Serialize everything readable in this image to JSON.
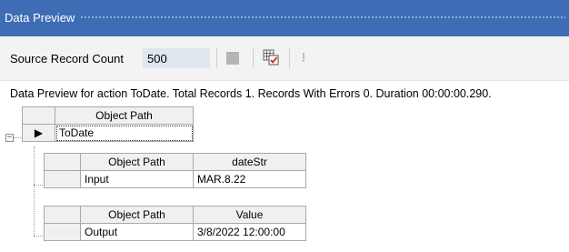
{
  "window": {
    "title": "Data Preview"
  },
  "toolbar": {
    "source_record_count_label": "Source Record Count",
    "source_record_count_value": "500",
    "stop_icon": "stop-icon",
    "grid_icon": "grid-check-icon",
    "warning_icon": "exclamation-icon",
    "warning_glyph": "!"
  },
  "status": {
    "message": "Data Preview for action ToDate. Total Records 1. Records With Errors 0. Duration 00:00:00.290."
  },
  "main_grid": {
    "header": "Object Path",
    "rows": [
      {
        "object_path": "ToDate",
        "expanded": true,
        "selected": true
      }
    ]
  },
  "child_grids": [
    {
      "headers": [
        "Object Path",
        "dateStr"
      ],
      "rows": [
        [
          "Input",
          "MAR.8.22"
        ]
      ]
    },
    {
      "headers": [
        "Object Path",
        "Value"
      ],
      "rows": [
        [
          "Output",
          "3/8/2022 12:00:00"
        ]
      ]
    }
  ],
  "colors": {
    "title_bar": "#3e6db5",
    "toolbar_bg": "#f3f3f3",
    "input_bg": "#dfe6ee",
    "grid_header_bg": "#f0f0f0"
  }
}
